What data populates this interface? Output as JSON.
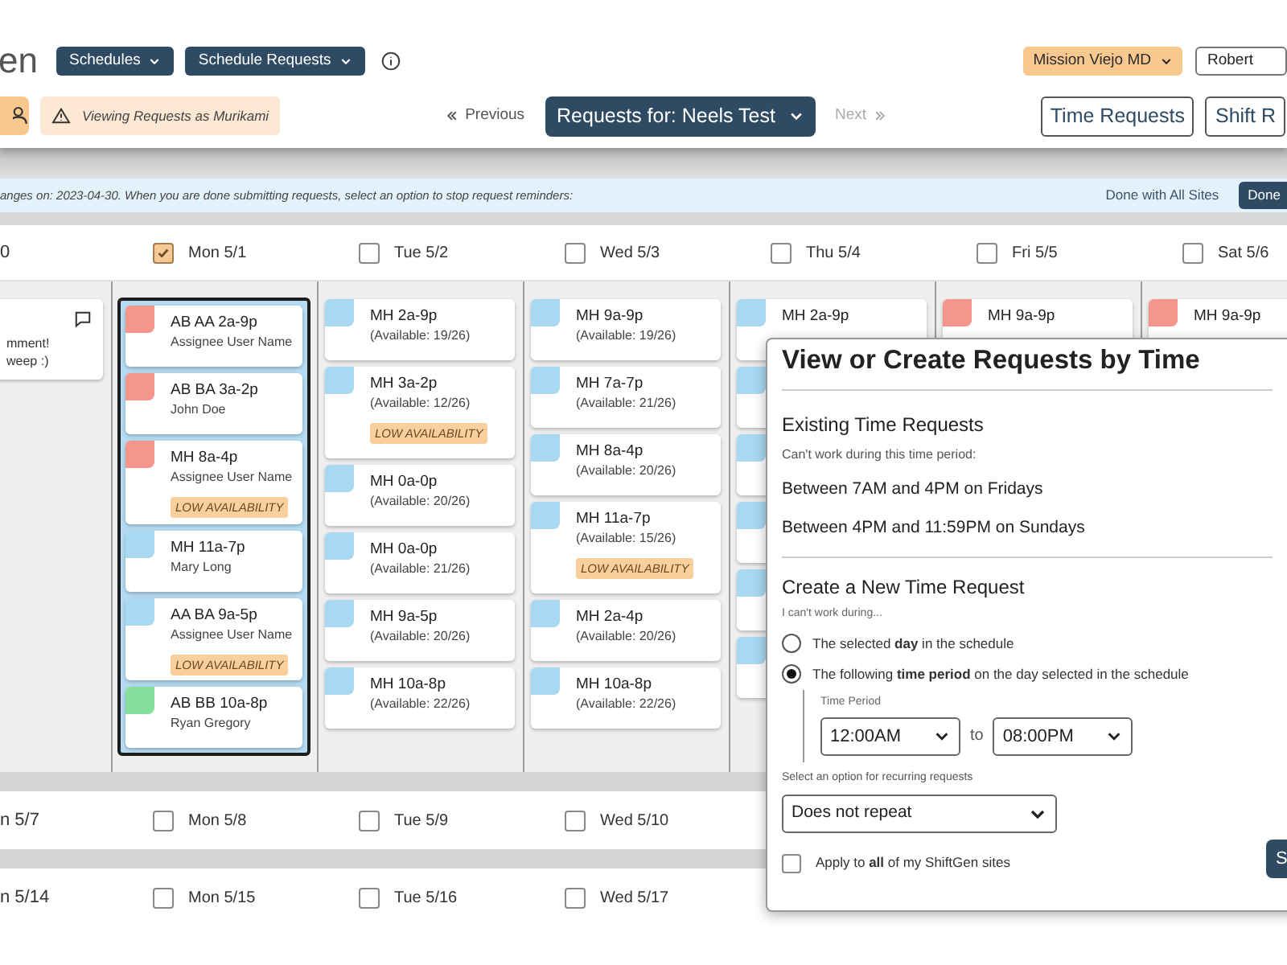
{
  "header": {
    "logo": "en",
    "menus": [
      {
        "label": "Schedules"
      },
      {
        "label": "Schedule Requests"
      }
    ],
    "site": "Mission Viejo MD",
    "user": "Robert",
    "viewing_notice": "Viewing Requests as Murikami",
    "previous": {
      "label": "Previous",
      "disabled": false
    },
    "requests_for": "Requests for: Neels Test",
    "next": {
      "label": "Next",
      "disabled": true
    },
    "actions": [
      "Time Requests",
      "Shift R"
    ]
  },
  "reminder_bar": {
    "text": "anges on: 2023-04-30. When you are done submitting requests, select an option to stop request reminders:",
    "done_all": "Done with All Sites",
    "done": "Done"
  },
  "week": {
    "days": [
      {
        "kind": "partial",
        "label": "0"
      },
      {
        "kind": "day",
        "label": "Mon 5/1",
        "checked": true
      },
      {
        "kind": "day",
        "label": "Tue 5/2",
        "checked": false
      },
      {
        "kind": "day",
        "label": "Wed 5/3",
        "checked": false
      },
      {
        "kind": "day",
        "label": "Thu 5/4",
        "checked": false
      },
      {
        "kind": "day",
        "label": "Fri 5/5",
        "checked": false
      },
      {
        "kind": "day",
        "label": "Sat 5/6",
        "checked": false
      }
    ],
    "columns": [
      {
        "selected": false,
        "comment": [
          "mment!",
          "weep :)"
        ]
      },
      {
        "selected": true,
        "cards": [
          {
            "title": "AB AA 2a-9p",
            "subtitle": "Assignee User Name",
            "color": "#f4968c"
          },
          {
            "title": "AB BA 3a-2p",
            "subtitle": "John Doe",
            "color": "#f4968c"
          },
          {
            "title": "MH 8a-4p",
            "subtitle": "Assignee User Name",
            "color": "#f4968c",
            "badge": "LOW AVAILABILITY"
          },
          {
            "title": "MH 11a-7p",
            "subtitle": "Mary Long",
            "color": "#a9d8f2"
          },
          {
            "title": "AA BA 9a-5p",
            "subtitle": "Assignee User Name",
            "color": "#a9d8f2",
            "badge": "LOW AVAILABILITY"
          },
          {
            "title": "AB BB 10a-8p",
            "subtitle": "Ryan Gregory",
            "color": "#85e09c"
          }
        ]
      },
      {
        "selected": false,
        "cards": [
          {
            "title": "MH 2a-9p",
            "subtitle": "(Available: 19/26)",
            "color": "#a9d8f2"
          },
          {
            "title": "MH 3a-2p",
            "subtitle": "(Available: 12/26)",
            "color": "#a9d8f2",
            "badge": "LOW AVAILABILITY"
          },
          {
            "title": "MH 0a-0p",
            "subtitle": "(Available: 20/26)",
            "color": "#a9d8f2"
          },
          {
            "title": "MH 0a-0p",
            "subtitle": "(Available: 21/26)",
            "color": "#a9d8f2"
          },
          {
            "title": "MH 9a-5p",
            "subtitle": "(Available: 20/26)",
            "color": "#a9d8f2"
          },
          {
            "title": "MH 10a-8p",
            "subtitle": "(Available: 22/26)",
            "color": "#a9d8f2"
          }
        ]
      },
      {
        "selected": false,
        "cards": [
          {
            "title": "MH 9a-9p",
            "subtitle": "(Available: 19/26)",
            "color": "#a9d8f2"
          },
          {
            "title": "MH 7a-7p",
            "subtitle": "(Available: 21/26)",
            "color": "#a9d8f2"
          },
          {
            "title": "MH 8a-4p",
            "subtitle": "(Available: 20/26)",
            "color": "#a9d8f2"
          },
          {
            "title": "MH 11a-7p",
            "subtitle": "(Available: 15/26)",
            "color": "#a9d8f2",
            "badge": "LOW AVAILABILITY"
          },
          {
            "title": "MH 2a-4p",
            "subtitle": "(Available: 20/26)",
            "color": "#a9d8f2"
          },
          {
            "title": "MH 10a-8p",
            "subtitle": "(Available: 22/26)",
            "color": "#a9d8f2"
          }
        ]
      },
      {
        "selected": false,
        "cards": [
          {
            "title": "MH 2a-9p",
            "color": "#a9d8f2"
          },
          {
            "color": "#a9d8f2"
          },
          {
            "color": "#a9d8f2"
          },
          {
            "color": "#a9d8f2"
          },
          {
            "color": "#a9d8f2"
          },
          {
            "color": "#a9d8f2"
          }
        ]
      },
      {
        "selected": false,
        "cards": [
          {
            "title": "MH 9a-9p",
            "color": "#f4968c"
          }
        ]
      },
      {
        "selected": false,
        "cards": [
          {
            "title": "MH 9a-9p",
            "color": "#f4968c"
          }
        ]
      }
    ]
  },
  "later_weeks": [
    {
      "days": [
        {
          "kind": "partial",
          "label": "n 5/7"
        },
        {
          "kind": "day",
          "label": "Mon 5/8",
          "checked": false
        },
        {
          "kind": "day",
          "label": "Tue 5/9",
          "checked": false
        },
        {
          "kind": "day",
          "label": "Wed 5/10",
          "checked": false
        }
      ]
    },
    {
      "days": [
        {
          "kind": "partial",
          "label": "n 5/14"
        },
        {
          "kind": "day",
          "label": "Mon 5/15",
          "checked": false
        },
        {
          "kind": "day",
          "label": "Tue 5/16",
          "checked": false
        },
        {
          "kind": "day",
          "label": "Wed 5/17",
          "checked": false
        }
      ]
    }
  ],
  "dialog": {
    "title": "View or Create Requests by Time",
    "existing_heading": "Existing Time Requests",
    "existing_hint": "Can't work during this time period:",
    "existing": [
      "Between 7AM and 4PM on Fridays",
      "Between 4PM and 11:59PM on Sundays"
    ],
    "create_heading": "Create a New Time Request",
    "create_hint": "I can't work during...",
    "options": [
      {
        "label": "The selected **day** in the schedule",
        "selected": false
      },
      {
        "label": "The following **time period** on the day selected in the schedule",
        "selected": true
      }
    ],
    "time_period_label": "Time Period",
    "from": "12:00AM",
    "to_label": "to",
    "to": "08:00PM",
    "recurring_label": "Select an option for recurring requests",
    "recurring": "Does not repeat",
    "apply_all": {
      "label": "Apply to **all** of my ShiftGen sites",
      "checked": false
    },
    "submit": "S"
  }
}
